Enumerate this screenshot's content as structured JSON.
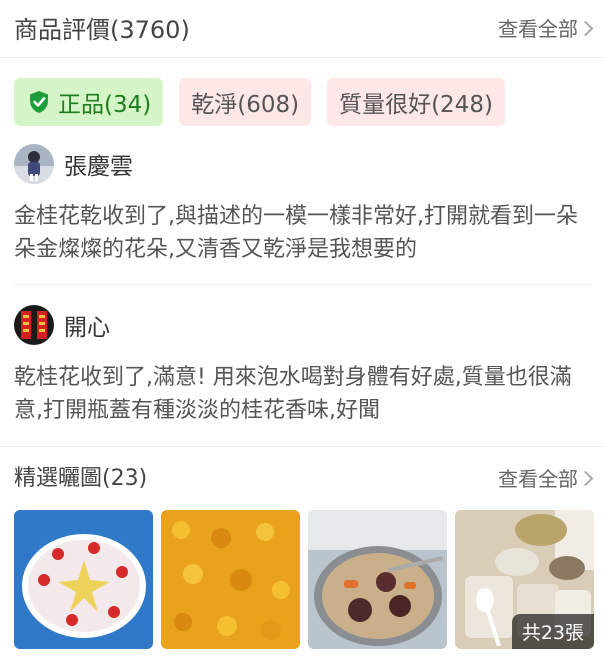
{
  "header": {
    "title": "商品評價(3760)",
    "more": "查看全部"
  },
  "tags": [
    {
      "label": "正品(34)",
      "icon": "shield-check-icon",
      "color": "#1e7d1e"
    },
    {
      "label": "乾淨(608)"
    },
    {
      "label": "質量很好(248)"
    }
  ],
  "reviews": [
    {
      "user": "張慶雲",
      "text": "金桂花乾收到了,與描述的一模一樣非常好,打開就看到一朵朵金燦燦的花朵,又清香又乾淨是我想要的"
    },
    {
      "user": "開心",
      "text": "乾桂花收到了,滿意! 用來泡水喝對身體有好處,質量也很滿意,打開瓶蓋有種淡淡的桂花香味,好聞"
    }
  ],
  "photos": {
    "title": "精選曬圖(23)",
    "more": "查看全部",
    "count_label": "共23張"
  }
}
